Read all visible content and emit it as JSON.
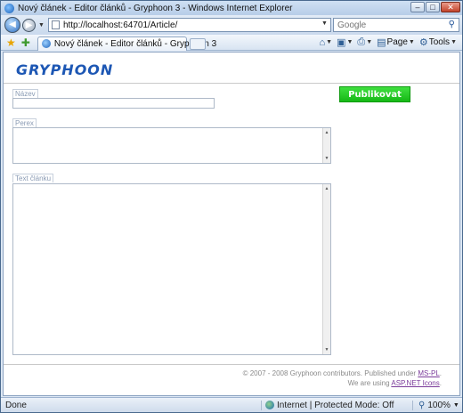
{
  "window": {
    "title": "Nový článek - Editor článků - Gryphoon 3 - Windows Internet Explorer",
    "controls": {
      "minimize": "–",
      "maximize": "□",
      "close": "✕"
    }
  },
  "address": {
    "url": "http://localhost:64701/Article/",
    "search_placeholder": "Google"
  },
  "tabs": [
    {
      "title": "Nový článek - Editor článků - Gryphoon 3"
    }
  ],
  "commandbar": {
    "page_label": "Page",
    "tools_label": "Tools"
  },
  "page": {
    "logo": "GRYPHOON",
    "form": {
      "title_label": "Název",
      "title_value": "",
      "perex_label": "Perex",
      "perex_value": "",
      "body_label": "Text článku",
      "body_value": ""
    },
    "publish_button": "Publikovat",
    "footer": {
      "line1_prefix": "© 2007 - 2008 Gryphoon contributors. Published under",
      "line1_link": "MS-PL",
      "line1_suffix": ".",
      "line2_prefix": "We are using",
      "line2_link": "ASP.NET Icons",
      "line2_suffix": "."
    }
  },
  "status": {
    "text": "Done",
    "zone": "Internet | Protected Mode: Off",
    "zoom": "100%"
  },
  "colors": {
    "publish_green": "#16b816",
    "logo_blue": "#1d57b4",
    "link_purple": "#7a3a9a"
  },
  "icons": [
    "ie-app-icon",
    "back-icon",
    "forward-icon",
    "refresh-icon",
    "stop-icon",
    "search-icon",
    "favorites-star-icon",
    "add-favorites-icon",
    "home-icon",
    "rss-icon",
    "print-icon",
    "page-icon",
    "tools-gear-icon",
    "globe-icon",
    "zoom-icon"
  ]
}
